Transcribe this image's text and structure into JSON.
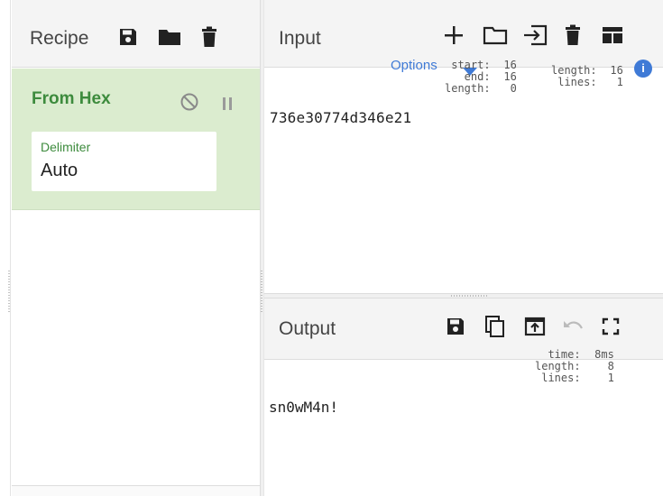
{
  "recipe": {
    "title": "Recipe",
    "icons": [
      "save-icon",
      "folder-icon",
      "trash-icon"
    ],
    "operation": {
      "name": "From Hex",
      "icons": [
        "disable-icon",
        "pause-icon"
      ],
      "arg_label": "Delimiter",
      "arg_value": "Auto"
    }
  },
  "input": {
    "title": "Input",
    "icons": [
      "plus-icon",
      "folder-open-icon",
      "open-in-icon",
      "trash-icon",
      "layout-icon"
    ],
    "value": "736e30774d346e21",
    "options_text": "Options",
    "stats_left": {
      "start_label": "start:",
      "start": "16",
      "end_label": "end:",
      "end": "16",
      "length_label": "length:",
      "length": "0"
    },
    "stats_right": {
      "length_label": "length:",
      "length": "16",
      "lines_label": "lines:",
      "lines": "1"
    }
  },
  "output": {
    "title": "Output",
    "icons": [
      "save-icon",
      "copy-icon",
      "replace-input-icon",
      "undo-icon",
      "fullscreen-icon"
    ],
    "value": "sn0wM4n!",
    "stats": {
      "time_label": "time:",
      "time": "8ms",
      "length_label": "length:",
      "length": "8",
      "lines_label": "lines:",
      "lines": "1"
    }
  },
  "colors": {
    "accent_green": "#3d8b3d",
    "operation_bg": "#dbeccf",
    "link_blue": "#3f7ad6",
    "header_bg": "#f4f4f4"
  }
}
